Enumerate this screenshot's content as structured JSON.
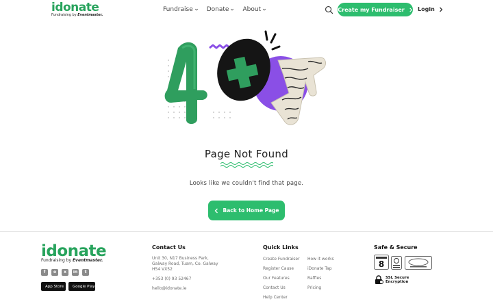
{
  "header": {
    "logo_text": "idonate",
    "logo_tagline": "Fundraising by",
    "logo_tagline_brand": "Eventmaster.",
    "nav": [
      {
        "label": "Fundraise"
      },
      {
        "label": "Donate"
      },
      {
        "label": "About"
      }
    ],
    "cta_label": "Create my Fundraiser",
    "login_label": "Login"
  },
  "main": {
    "title": "Page Not Found",
    "message": "Looks like we couldn't find that page.",
    "home_button": "Back to Home Page"
  },
  "footer": {
    "logo_text": "idonate",
    "logo_tagline": "Fundraising by",
    "logo_tagline_brand": "Eventmaster.",
    "socials": [
      "f",
      "o",
      "x",
      "in",
      "t"
    ],
    "app_store": "App Store",
    "google_play": "Google Play",
    "contact": {
      "title": "Contact Us",
      "address_line1": "Unit 30, N17 Business Park,",
      "address_line2": "Galway Road, Tuam, Co. Galway",
      "address_line3": "H54 VX52",
      "phone": "+353 (0) 93 52467",
      "email": "hello@idonate.ie"
    },
    "quick_links": {
      "title": "Quick Links",
      "col1": [
        "Create Fundraiser",
        "Register Cause",
        "Our Features",
        "Contact Us",
        "Help Center"
      ],
      "col2": [
        "How it works",
        "iDonate Tap",
        "Raffles",
        "Pricing"
      ]
    },
    "safe": {
      "title": "Safe & Secure",
      "ssl_line1": "SSL Secure",
      "ssl_line2": "Encryption"
    }
  },
  "colors": {
    "brand_green": "#2dbd6e",
    "logo_green": "#27a35c",
    "accent_purple": "#8a4fe6"
  }
}
